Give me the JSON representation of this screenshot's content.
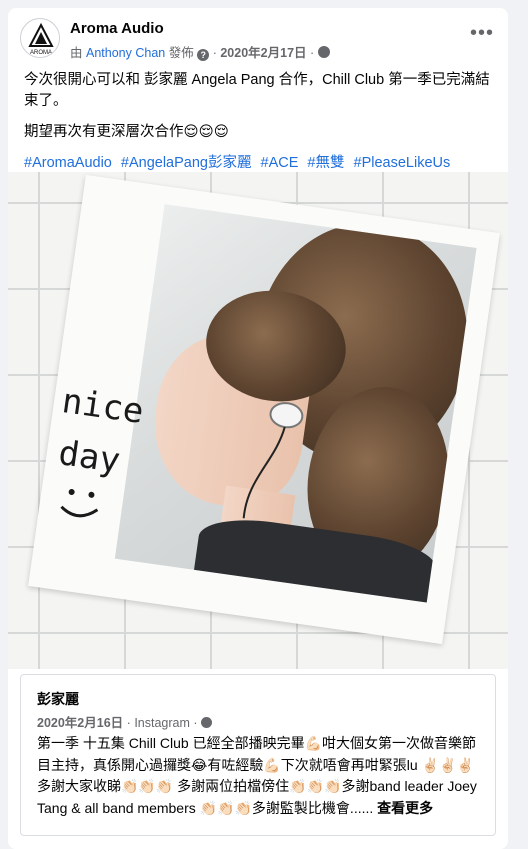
{
  "post": {
    "page_name": "Aroma Audio",
    "by_prefix": "由",
    "author": "Anthony Chan",
    "posted_word": "發佈",
    "help_glyph": "?",
    "dot": "·",
    "date": "2020年2月17日",
    "more_glyph": "•••",
    "logo_text": "AROMA",
    "lines": [
      "今次很開心可以和 彭家麗 Angela Pang 合作，Chill Club 第一季已完滿結束了。",
      "期望再次有更深層次合作😌😌😌"
    ],
    "hashtags": [
      "#AromaAudio",
      "#AngelaPang彭家麗",
      "#ACE",
      "#無雙",
      "#PleaseLikeUs"
    ]
  },
  "photo": {
    "handwriting_line1": "nice",
    "handwriting_line2": "day"
  },
  "shared": {
    "name": "彭家麗",
    "date": "2020年2月16日",
    "dot": "·",
    "source": "Instagram",
    "body": "第一季 十五集 Chill Club 已經全部播映完畢💪🏻咁大個女第一次做音樂節目主持，真係開心過攞獎😂有咗經驗💪🏻下次就唔會再咁緊張lu ✌🏻✌🏻✌🏻多謝大家收睇👏🏻👏🏻👏🏻 多謝兩位拍檔傍住👏🏻👏🏻👏🏻多謝band leader Joey Tang & all band members 👏🏻👏🏻👏🏻多謝監製比機會......",
    "see_more": "查看更多"
  },
  "colors": {
    "link": "#216fdb",
    "secondary_text": "#65676b",
    "background": "#f0f2f5"
  }
}
